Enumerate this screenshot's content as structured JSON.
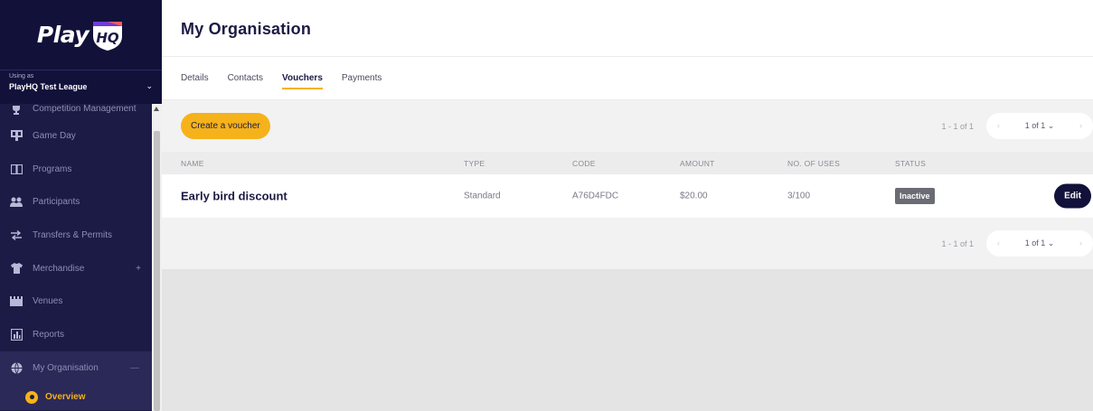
{
  "sidebar": {
    "logo_text": "Play",
    "logo_badge": "HQ",
    "using_label": "Using as",
    "org_name": "PlayHQ Test League",
    "items": [
      {
        "label": "Competition Management",
        "icon": "trophy-icon"
      },
      {
        "label": "Game Day",
        "icon": "scoreboard-icon"
      },
      {
        "label": "Programs",
        "icon": "book-icon"
      },
      {
        "label": "Participants",
        "icon": "people-icon"
      },
      {
        "label": "Transfers & Permits",
        "icon": "transfer-icon"
      },
      {
        "label": "Merchandise",
        "icon": "shirt-icon",
        "suffix": "+"
      },
      {
        "label": "Venues",
        "icon": "stadium-icon"
      },
      {
        "label": "Reports",
        "icon": "chart-icon"
      },
      {
        "label": "My Organisation",
        "icon": "globe-icon",
        "suffix": "—"
      }
    ],
    "sub_item": "Overview"
  },
  "header": {
    "title": "My Organisation"
  },
  "tabs": [
    {
      "label": "Details"
    },
    {
      "label": "Contacts"
    },
    {
      "label": "Vouchers",
      "active": true
    },
    {
      "label": "Payments"
    }
  ],
  "toolbar": {
    "create_label": "Create a voucher",
    "range": "1 - 1 of 1",
    "page": "1 of 1"
  },
  "table": {
    "columns": [
      "NAME",
      "TYPE",
      "CODE",
      "AMOUNT",
      "NO. OF USES",
      "STATUS"
    ],
    "rows": [
      {
        "name": "Early bird discount",
        "type": "Standard",
        "code": "A76D4FDC",
        "amount": "$20.00",
        "uses": "3/100",
        "status": "Inactive",
        "action": "Edit"
      }
    ]
  },
  "footer": {
    "range": "1 - 1 of 1",
    "page": "1 of 1"
  },
  "colors": {
    "navy": "#1c1b45",
    "accent": "#f6b21b",
    "badge": "#6b6b74"
  }
}
